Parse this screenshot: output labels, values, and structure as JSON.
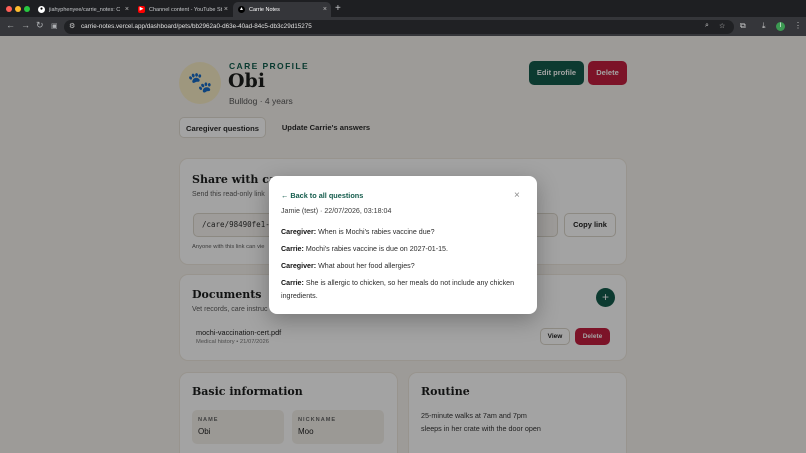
{
  "browser": {
    "tabs": [
      {
        "title": "jiahyphenyee/carrie_notes: C",
        "active": false,
        "icon": "github-icon"
      },
      {
        "title": "Channel content - YouTube St",
        "active": false,
        "icon": "youtube-icon"
      },
      {
        "title": "Carrie Notes",
        "active": true,
        "icon": "vercel-icon"
      }
    ],
    "url": "carrie-notes.vercel.app/dashboard/pets/bb2962a0-d63e-40ad-84c5-db3c29d15275",
    "profile_initial": "I"
  },
  "profile": {
    "eyebrow": "CARE PROFILE",
    "name": "Obi",
    "subtitle": "Bulldog · 4 years",
    "avatar_icon": "paw-icon",
    "edit_label": "Edit profile",
    "delete_label": "Delete"
  },
  "tabs": {
    "items": [
      {
        "label": "Caregiver questions",
        "active": true
      },
      {
        "label": "Update Carrie's answers",
        "active": false
      }
    ]
  },
  "share": {
    "title": "Share with car",
    "description": "Send this read-only link",
    "link_value": "/care/98490fe1-e",
    "copy_label": "Copy link",
    "footnote": "Anyone with this link can vie"
  },
  "documents": {
    "title": "Documents",
    "description": "Vet records, care instruc",
    "items": [
      {
        "name": "mochi-vaccination-cert.pdf",
        "meta": "Medical history • 21/07/2026",
        "view_label": "View",
        "delete_label": "Delete"
      }
    ]
  },
  "basic_info": {
    "title": "Basic information",
    "fields": [
      {
        "label": "NAME",
        "value": "Obi"
      },
      {
        "label": "NICKNAME",
        "value": "Moo"
      }
    ]
  },
  "routine": {
    "title": "Routine",
    "lines": [
      "25-minute walks at 7am and 7pm",
      "sleeps in her crate with the door open"
    ]
  },
  "modal": {
    "back_label": "← Back to all questions",
    "meta": "Jamie (test) · 22/07/2026, 03:18:04",
    "messages": [
      {
        "speaker": "Caregiver:",
        "text": " When is Mochi's rabies vaccine due?"
      },
      {
        "speaker": "Carrie:",
        "text": " Mochi's rabies vaccine is due on 2027-01-15."
      },
      {
        "speaker": "Caregiver:",
        "text": " What about her food allergies?"
      },
      {
        "speaker": "Carrie:",
        "text": " She is allergic to chicken, so her meals do not include any chicken ingredients."
      }
    ]
  },
  "colors": {
    "brand_green": "#145c4c",
    "danger_red": "#c21f3f",
    "page_bg": "#f6f3ee"
  }
}
